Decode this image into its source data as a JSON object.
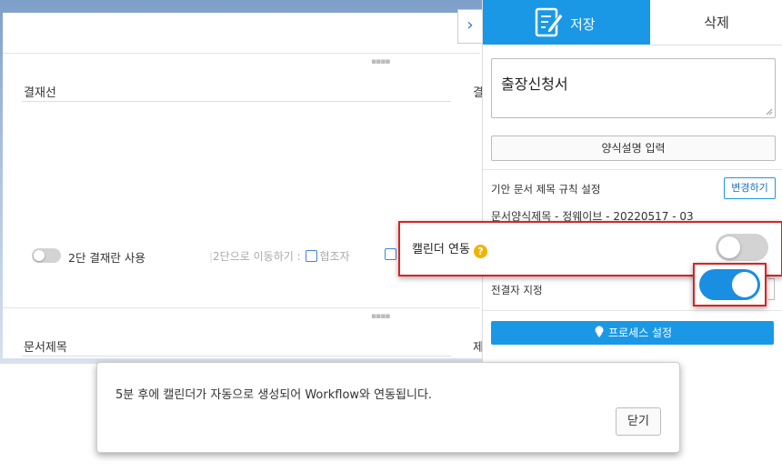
{
  "form": {
    "approval_line_label": "결재선",
    "approval_line_label_cut": "결",
    "two_level_label": "2단 결재란 사용",
    "move_label": "2단으로 이동하기 :",
    "cooperator_label": "협조자",
    "doc_title_label": "문서제목",
    "doc_title_label_cut": "제"
  },
  "expand_icon": "›",
  "panel": {
    "save_tab": "저장",
    "save_icon": "edit-document-icon",
    "delete_tab": "삭제",
    "form_title": "출장신청서",
    "desc_button": "양식설명 입력",
    "rule_label": "기안 문서 제목 규칙 설정",
    "change_button": "변경하기",
    "rule_sample": "문서양식제목 - 정웨이브 - 20220517 - 03",
    "approver_label": "전결자 지정",
    "process_button": "프로세스 설정"
  },
  "calendar": {
    "label": "캘린더 연동",
    "help": "?",
    "enabled": false
  },
  "approver_toggle": {
    "enabled": true
  },
  "toast": {
    "message": "5분 후에 캘린더가 자동으로 생성되어 Workflow와 연동됩니다.",
    "close_button": "닫기"
  },
  "colors": {
    "accent": "#1a98e6",
    "highlight": "#e02020",
    "help": "#f0b400"
  }
}
